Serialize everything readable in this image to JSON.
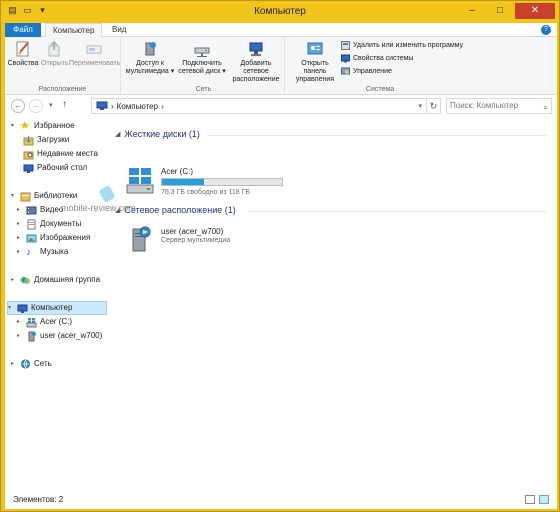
{
  "window": {
    "title": "Компьютер",
    "controls": [
      "–",
      "□",
      "✕"
    ]
  },
  "tabs": {
    "file": "Файл",
    "computer": "Компьютер",
    "view": "Вид"
  },
  "ribbon": {
    "location": {
      "label": "Расположение",
      "properties": "Свойства",
      "open": "Открыть",
      "rename": "Переименовать"
    },
    "network": {
      "label": "Сеть",
      "media_access_line1": "Доступ к",
      "media_access_line2": "мультимедиа",
      "map_drive_line1": "Подключить",
      "map_drive_line2": "сетевой диск",
      "add_location_line1": "Добавить сетевое",
      "add_location_line2": "расположение"
    },
    "system": {
      "label": "Система",
      "control_panel_line1": "Открыть панель",
      "control_panel_line2": "управления",
      "uninstall": "Удалить или изменить программу",
      "system_props": "Свойства системы",
      "manage": "Управление"
    }
  },
  "address": {
    "path": "Компьютер",
    "search_placeholder": "Поиск: Компьютер"
  },
  "nav": {
    "favorites": "Избранное",
    "downloads": "Загрузки",
    "recent": "Недавние места",
    "desktop": "Рабочий стол",
    "libraries": "Библиотеки",
    "video": "Видео",
    "documents": "Документы",
    "images": "Изображения",
    "music": "Музыка",
    "homegroup": "Домашняя группа",
    "computer": "Компьютер",
    "drive_c": "Acer (C:)",
    "user_share": "user (acer_w700)",
    "network": "Сеть"
  },
  "content": {
    "hard_drives_header": "Жесткие диски (1)",
    "drive_name": "Acer (C:)",
    "drive_free_text": "76,3 ГБ свободно из 118 ГБ",
    "drive_used_fraction": 0.35,
    "network_header": "Сетевое расположение (1)",
    "net_item_name": "user (acer_w700)",
    "net_item_type": "Сервер мультимедиа"
  },
  "watermark": "mobile-review.com",
  "status": {
    "items_count": "Элементов: 2"
  },
  "colors": {
    "title_bar": "#f0c419",
    "file_tab": "#1979ca",
    "drive_bar": "#26a0da",
    "selection": "#cce8ff",
    "header_text": "#1e3287"
  }
}
